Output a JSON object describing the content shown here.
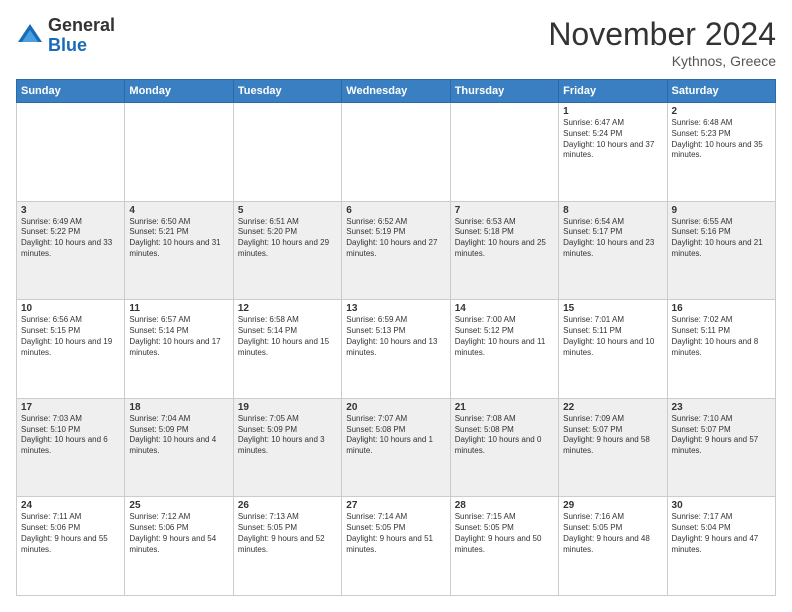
{
  "header": {
    "logo_general": "General",
    "logo_blue": "Blue",
    "month_title": "November 2024",
    "location": "Kythnos, Greece"
  },
  "weekdays": [
    "Sunday",
    "Monday",
    "Tuesday",
    "Wednesday",
    "Thursday",
    "Friday",
    "Saturday"
  ],
  "weeks": [
    [
      {
        "day": "",
        "info": ""
      },
      {
        "day": "",
        "info": ""
      },
      {
        "day": "",
        "info": ""
      },
      {
        "day": "",
        "info": ""
      },
      {
        "day": "",
        "info": ""
      },
      {
        "day": "1",
        "info": "Sunrise: 6:47 AM\nSunset: 5:24 PM\nDaylight: 10 hours and 37 minutes."
      },
      {
        "day": "2",
        "info": "Sunrise: 6:48 AM\nSunset: 5:23 PM\nDaylight: 10 hours and 35 minutes."
      }
    ],
    [
      {
        "day": "3",
        "info": "Sunrise: 6:49 AM\nSunset: 5:22 PM\nDaylight: 10 hours and 33 minutes."
      },
      {
        "day": "4",
        "info": "Sunrise: 6:50 AM\nSunset: 5:21 PM\nDaylight: 10 hours and 31 minutes."
      },
      {
        "day": "5",
        "info": "Sunrise: 6:51 AM\nSunset: 5:20 PM\nDaylight: 10 hours and 29 minutes."
      },
      {
        "day": "6",
        "info": "Sunrise: 6:52 AM\nSunset: 5:19 PM\nDaylight: 10 hours and 27 minutes."
      },
      {
        "day": "7",
        "info": "Sunrise: 6:53 AM\nSunset: 5:18 PM\nDaylight: 10 hours and 25 minutes."
      },
      {
        "day": "8",
        "info": "Sunrise: 6:54 AM\nSunset: 5:17 PM\nDaylight: 10 hours and 23 minutes."
      },
      {
        "day": "9",
        "info": "Sunrise: 6:55 AM\nSunset: 5:16 PM\nDaylight: 10 hours and 21 minutes."
      }
    ],
    [
      {
        "day": "10",
        "info": "Sunrise: 6:56 AM\nSunset: 5:15 PM\nDaylight: 10 hours and 19 minutes."
      },
      {
        "day": "11",
        "info": "Sunrise: 6:57 AM\nSunset: 5:14 PM\nDaylight: 10 hours and 17 minutes."
      },
      {
        "day": "12",
        "info": "Sunrise: 6:58 AM\nSunset: 5:14 PM\nDaylight: 10 hours and 15 minutes."
      },
      {
        "day": "13",
        "info": "Sunrise: 6:59 AM\nSunset: 5:13 PM\nDaylight: 10 hours and 13 minutes."
      },
      {
        "day": "14",
        "info": "Sunrise: 7:00 AM\nSunset: 5:12 PM\nDaylight: 10 hours and 11 minutes."
      },
      {
        "day": "15",
        "info": "Sunrise: 7:01 AM\nSunset: 5:11 PM\nDaylight: 10 hours and 10 minutes."
      },
      {
        "day": "16",
        "info": "Sunrise: 7:02 AM\nSunset: 5:11 PM\nDaylight: 10 hours and 8 minutes."
      }
    ],
    [
      {
        "day": "17",
        "info": "Sunrise: 7:03 AM\nSunset: 5:10 PM\nDaylight: 10 hours and 6 minutes."
      },
      {
        "day": "18",
        "info": "Sunrise: 7:04 AM\nSunset: 5:09 PM\nDaylight: 10 hours and 4 minutes."
      },
      {
        "day": "19",
        "info": "Sunrise: 7:05 AM\nSunset: 5:09 PM\nDaylight: 10 hours and 3 minutes."
      },
      {
        "day": "20",
        "info": "Sunrise: 7:07 AM\nSunset: 5:08 PM\nDaylight: 10 hours and 1 minute."
      },
      {
        "day": "21",
        "info": "Sunrise: 7:08 AM\nSunset: 5:08 PM\nDaylight: 10 hours and 0 minutes."
      },
      {
        "day": "22",
        "info": "Sunrise: 7:09 AM\nSunset: 5:07 PM\nDaylight: 9 hours and 58 minutes."
      },
      {
        "day": "23",
        "info": "Sunrise: 7:10 AM\nSunset: 5:07 PM\nDaylight: 9 hours and 57 minutes."
      }
    ],
    [
      {
        "day": "24",
        "info": "Sunrise: 7:11 AM\nSunset: 5:06 PM\nDaylight: 9 hours and 55 minutes."
      },
      {
        "day": "25",
        "info": "Sunrise: 7:12 AM\nSunset: 5:06 PM\nDaylight: 9 hours and 54 minutes."
      },
      {
        "day": "26",
        "info": "Sunrise: 7:13 AM\nSunset: 5:05 PM\nDaylight: 9 hours and 52 minutes."
      },
      {
        "day": "27",
        "info": "Sunrise: 7:14 AM\nSunset: 5:05 PM\nDaylight: 9 hours and 51 minutes."
      },
      {
        "day": "28",
        "info": "Sunrise: 7:15 AM\nSunset: 5:05 PM\nDaylight: 9 hours and 50 minutes."
      },
      {
        "day": "29",
        "info": "Sunrise: 7:16 AM\nSunset: 5:05 PM\nDaylight: 9 hours and 48 minutes."
      },
      {
        "day": "30",
        "info": "Sunrise: 7:17 AM\nSunset: 5:04 PM\nDaylight: 9 hours and 47 minutes."
      }
    ]
  ]
}
